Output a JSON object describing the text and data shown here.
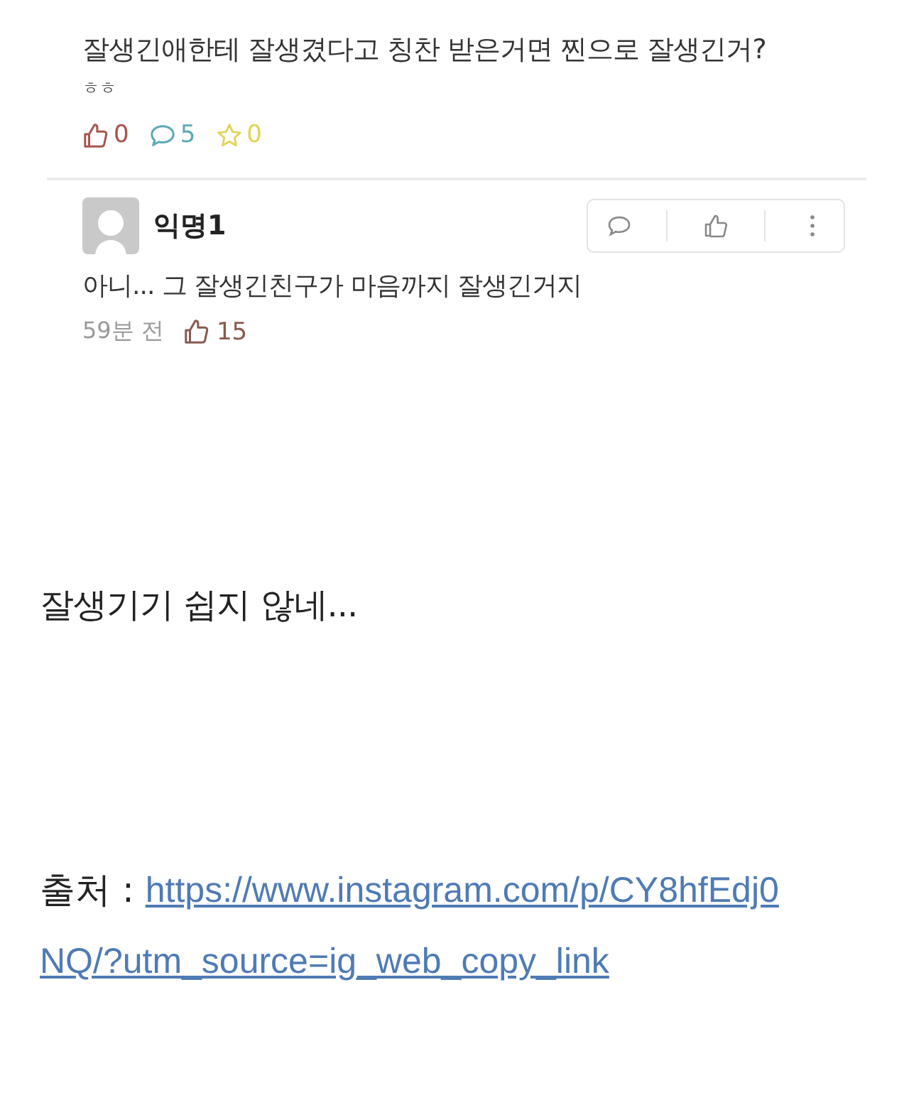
{
  "post": {
    "body": "잘생긴애한테 잘생겼다고 칭찬 받은거면 찐으로 잘생긴거?",
    "note": "ㅎㅎ",
    "stats": [
      {
        "kind": "like",
        "count": "0",
        "color": "#a5574e"
      },
      {
        "kind": "comment",
        "count": "5",
        "color": "#5ea9b4"
      },
      {
        "kind": "star",
        "count": "0",
        "color": "#e2d45a"
      }
    ]
  },
  "comment": {
    "author": "익명1",
    "text": "아니... 그 잘생긴친구가 마음까지 잘생긴거지",
    "time": "59분 전",
    "likes": "15"
  },
  "caption": "잘생기기 쉽지 않네...",
  "source": {
    "label": "출처 :",
    "url_lines": [
      "https://www.instagram.com/p/CY8hfEdj0",
      "NQ/?utm_source=ig_web_copy_link"
    ]
  }
}
